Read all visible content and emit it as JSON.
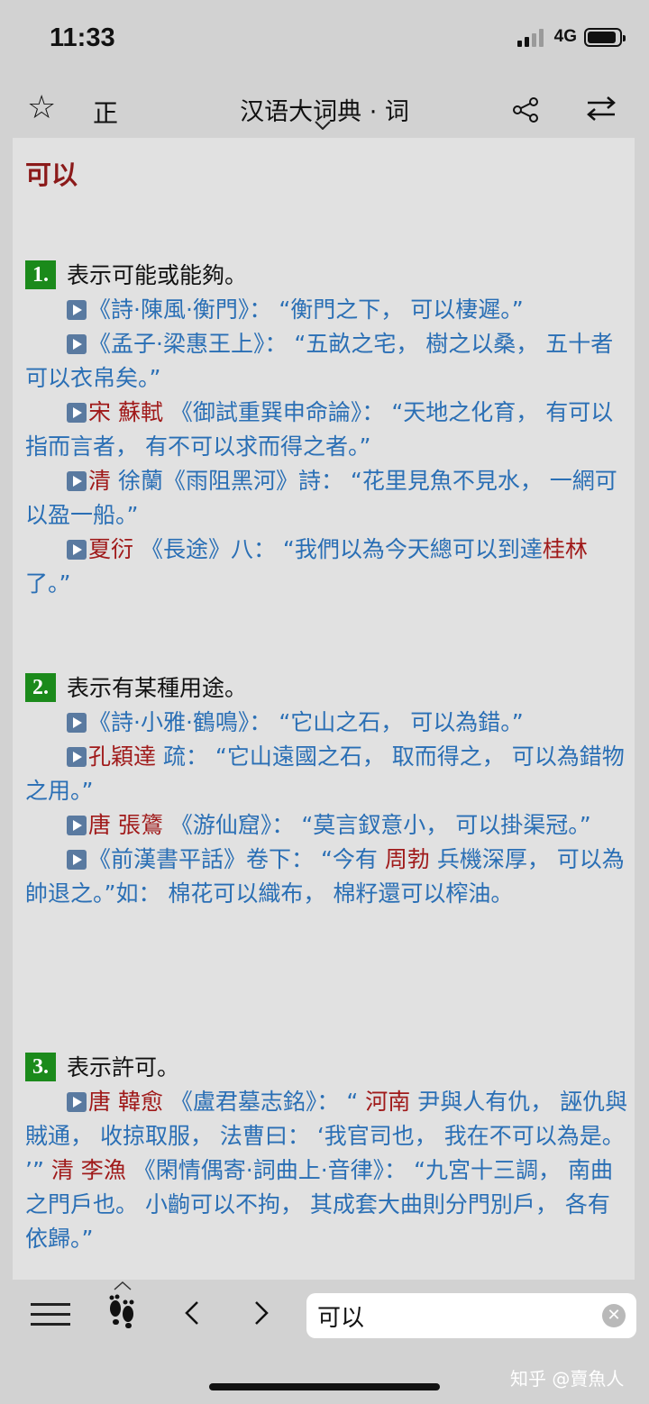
{
  "status": {
    "time": "11:33",
    "network": "4G",
    "battery_level": 0.9
  },
  "toolbar": {
    "star_icon": "star-outline",
    "mode_label": "正",
    "dict_title": "汉语大词典 · 词"
  },
  "entry": {
    "headword": "可以",
    "senses": [
      {
        "num": "1.",
        "definition": "表示可能或能夠。",
        "citations": [
          [
            {
              "t": "《詩·陳風·衡門》： “衡門之下， 可以棲遲。”"
            }
          ],
          [
            {
              "t": "《孟子·梁惠王上》： “五畝之宅， 樹之以桑， 五十者可以衣帛矣。”"
            }
          ],
          [
            {
              "t": "宋 蘇軾",
              "red": true
            },
            {
              "t": " 《御試重巽申命論》： “天地之化育， 有可以指而言者， 有不可以求而得之者。”"
            }
          ],
          [
            {
              "t": "清",
              "red": true
            },
            {
              "t": " 徐蘭《雨阻黑河》詩： “花里見魚不見水， 一網可以盈一船。”"
            }
          ],
          [
            {
              "t": "夏衍",
              "red": true
            },
            {
              "t": " 《長途》八： “我們以為今天總可以到達"
            },
            {
              "t": "桂林",
              "red": true
            },
            {
              "t": " 了。”"
            }
          ]
        ]
      },
      {
        "num": "2.",
        "definition": "表示有某種用途。",
        "citations": [
          [
            {
              "t": "《詩·小雅·鶴鳴》： “它山之石， 可以為錯。”"
            }
          ],
          [
            {
              "t": "孔穎達",
              "red": true
            },
            {
              "t": " 疏： “它山遠國之石， 取而得之， 可以為錯物之用。”"
            }
          ],
          [
            {
              "t": "唐 張鷟",
              "red": true
            },
            {
              "t": " 《游仙窟》： “莫言釵意小， 可以掛渠冠。”"
            }
          ],
          [
            {
              "t": "《前漢書平話》卷下： “今有 "
            },
            {
              "t": "周勃",
              "red": true
            },
            {
              "t": " 兵機深厚， 可以為帥退之。”如： 棉花可以織布， 棉籽還可以榨油。"
            }
          ]
        ]
      },
      {
        "num": "3.",
        "definition": "表示許可。",
        "citations": [
          [
            {
              "t": "唐 韓愈",
              "red": true
            },
            {
              "t": " 《盧君墓志銘》： “ "
            },
            {
              "t": "河南",
              "red": true
            },
            {
              "t": " 尹與人有仇， 誣仇與賊通， 收掠取服， 法曹曰： ‘我官司也， 我在不可以為是。 ’” "
            },
            {
              "t": "清 李漁",
              "red": true
            },
            {
              "t": " 《閑情偶寄·詞曲上·音律》： “九宮十三調， 南曲之門戶也。 小齣可以不拘， 其成套大曲則分門別戶， 各有依歸。”"
            }
          ]
        ]
      }
    ]
  },
  "bottom": {
    "search_value": "可以",
    "clear_label": "✕",
    "watermark": "知乎 @賣魚人"
  }
}
